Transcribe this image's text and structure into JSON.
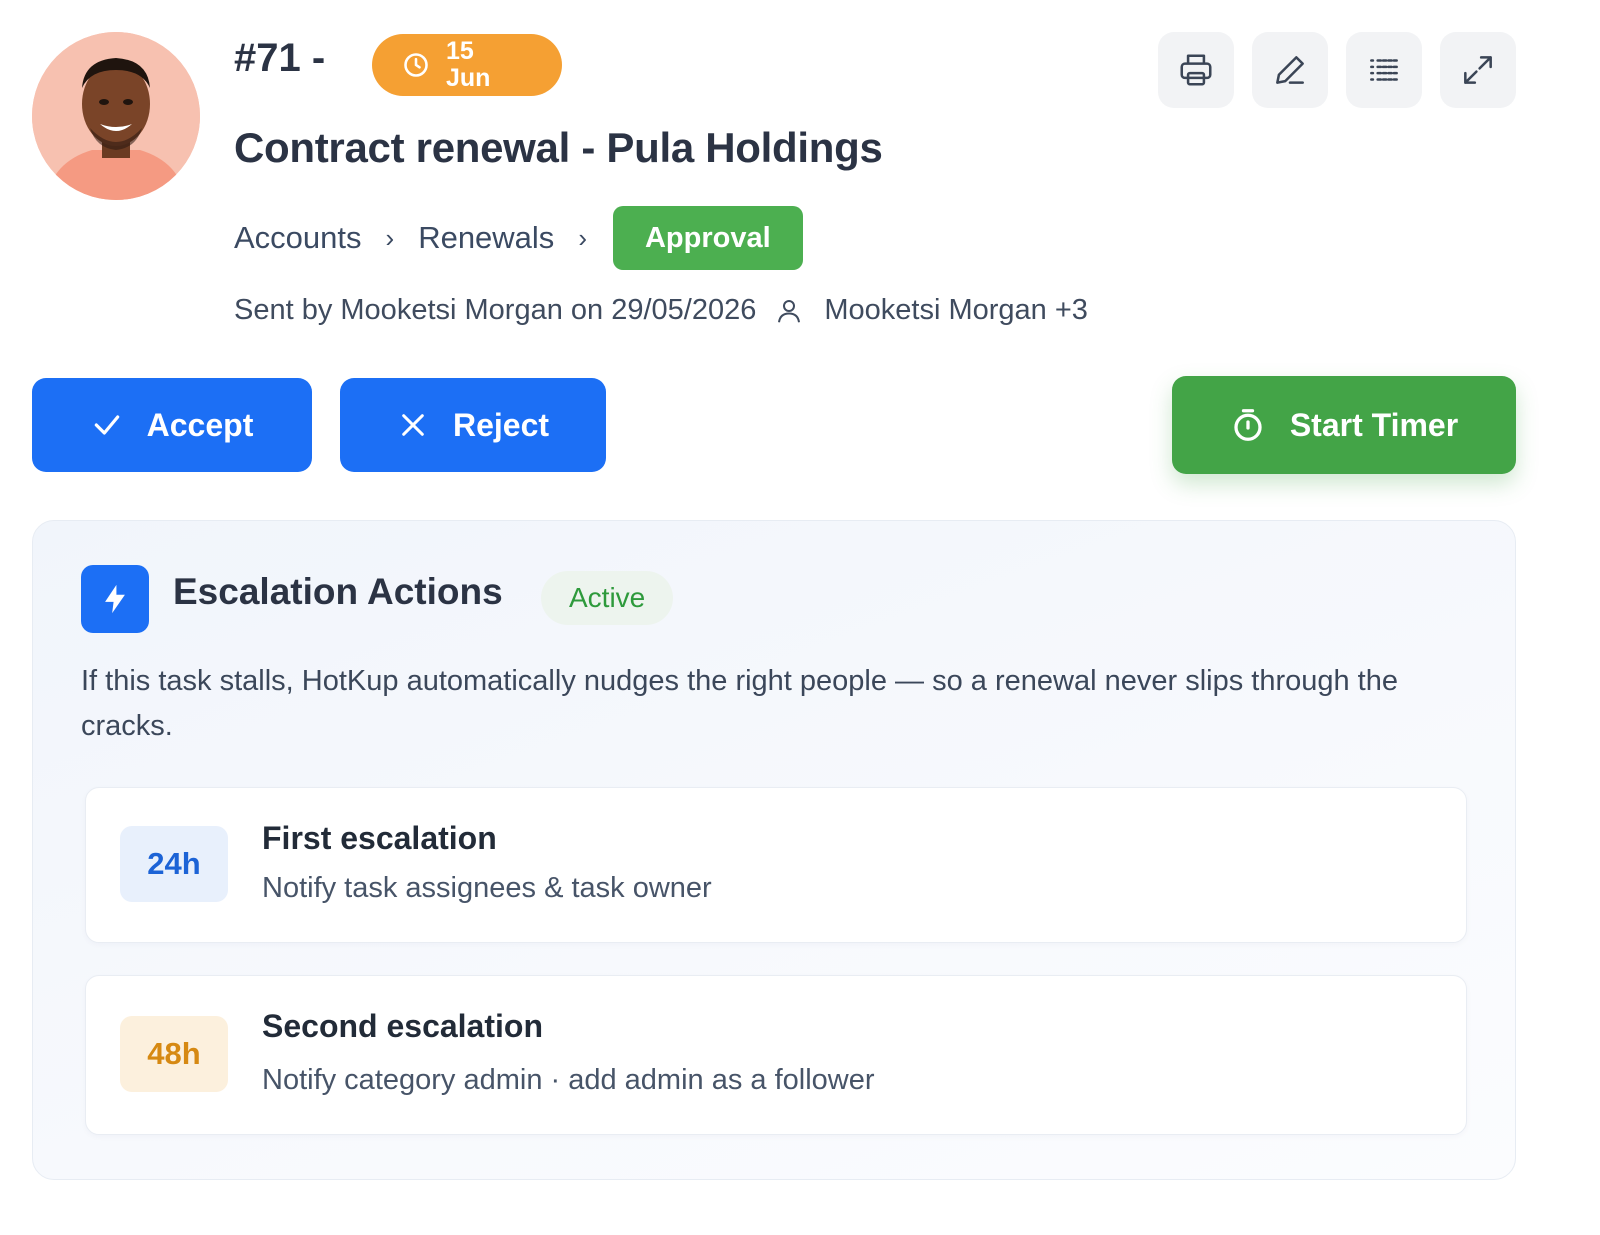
{
  "header": {
    "task_id": "#71 -",
    "due_day": "15",
    "due_month": "Jun",
    "title": "Contract renewal - Pula Holdings"
  },
  "toolbar": {
    "icons": [
      "printer-icon",
      "pencil-icon",
      "list-icon",
      "expand-icon"
    ]
  },
  "breadcrumb": {
    "items": [
      "Accounts",
      "Renewals"
    ],
    "stage": "Approval"
  },
  "meta": {
    "sent_text": "Sent by Mooketsi Morgan on 29/05/2026",
    "assignees": "Mooketsi Morgan +3"
  },
  "actions": {
    "accept_label": "Accept",
    "reject_label": "Reject",
    "timer_label": "Start Timer"
  },
  "escalation": {
    "title": "Escalation Actions",
    "status": "Active",
    "description": "If this task stalls, HotKup automatically nudges the right people — so a renewal never slips through the cracks.",
    "steps": [
      {
        "tag": "24h",
        "title": "First escalation",
        "description": "Notify task assignees & task owner"
      },
      {
        "tag": "48h",
        "title": "Second escalation",
        "description": "Notify category admin · add admin as a follower"
      }
    ]
  },
  "colors": {
    "primary": "#1c6ff5",
    "success": "#43a447",
    "warning": "#f5a033",
    "text": "#2b3344"
  }
}
